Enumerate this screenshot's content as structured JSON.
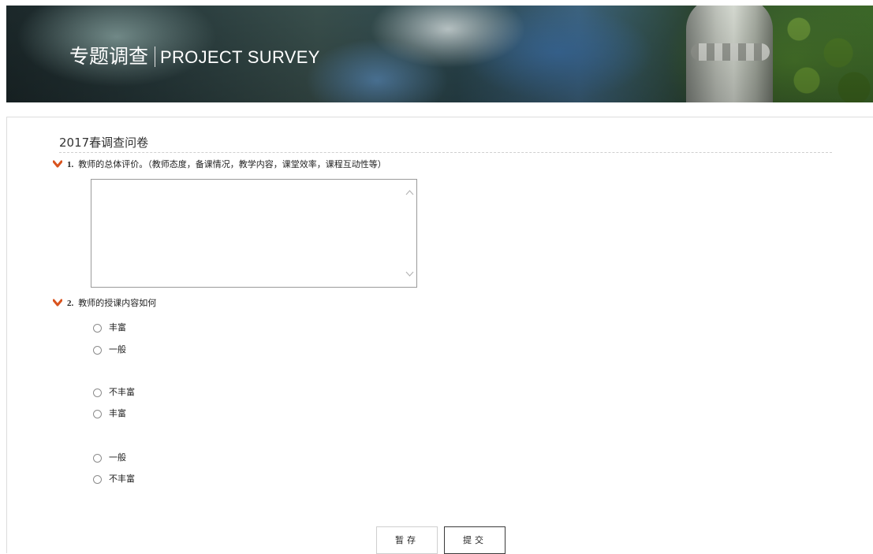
{
  "banner": {
    "title_cn": "专题调查",
    "title_en": "PROJECT SURVEY"
  },
  "survey": {
    "title": "2017春调查问卷"
  },
  "questions": [
    {
      "number": "1.",
      "text": "教师的总体评价。（教师态度，备课情况，教学内容，课堂效率，课程互动性等）",
      "answer_value": ""
    },
    {
      "number": "2.",
      "text": "教师的授课内容如何",
      "options": [
        "丰富",
        "一般",
        "不丰富",
        "丰富",
        "一般",
        "不丰富"
      ]
    }
  ],
  "buttons": {
    "save": "暂存",
    "submit": "提交"
  },
  "colors": {
    "accent_chevron": "#d9531e"
  }
}
